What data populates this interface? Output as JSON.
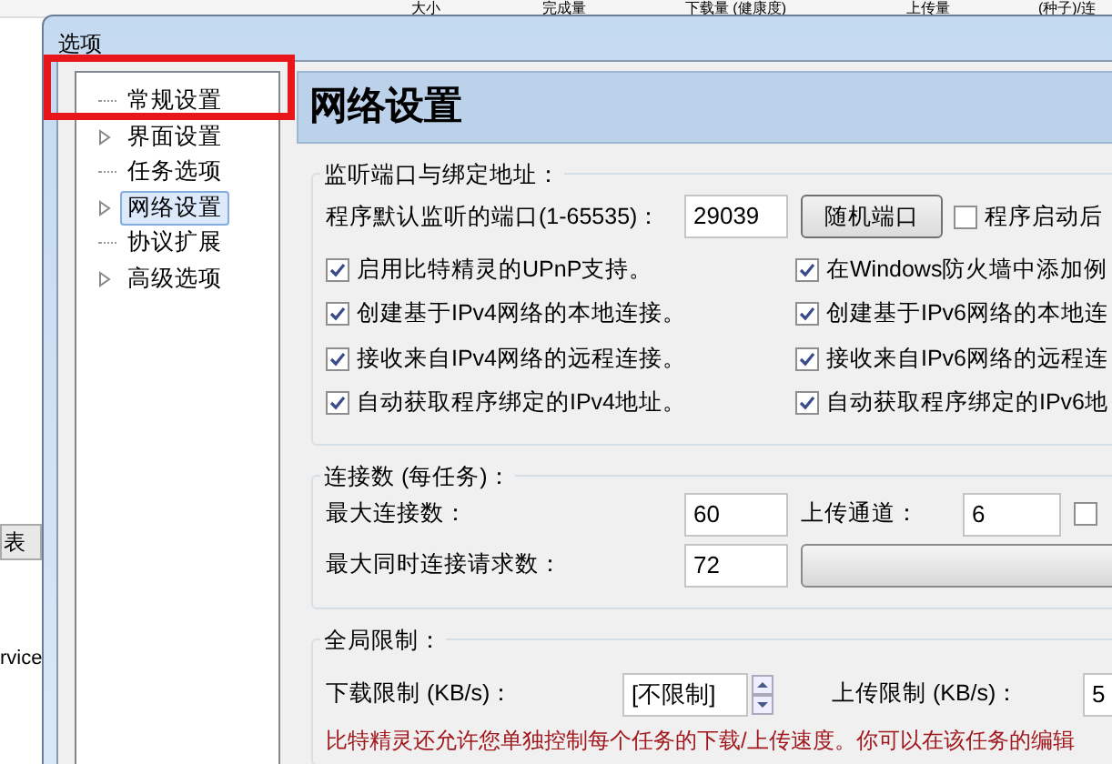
{
  "background_app": {
    "columns": [
      "大小",
      "完成量",
      "下载量 (健康度)",
      "上传量",
      "(种子)/连"
    ],
    "tab": "表",
    "text": "rvice"
  },
  "dialog": {
    "title": "选项"
  },
  "tree": [
    {
      "label": "常规设置",
      "expandable": false,
      "selected": false,
      "highlighted": true
    },
    {
      "label": "界面设置",
      "expandable": true,
      "selected": false
    },
    {
      "label": "任务选项",
      "expandable": false,
      "selected": false
    },
    {
      "label": "网络设置",
      "expandable": true,
      "selected": true
    },
    {
      "label": "协议扩展",
      "expandable": false,
      "selected": false
    },
    {
      "label": "高级选项",
      "expandable": true,
      "selected": false
    }
  ],
  "page": {
    "heading": "网络设置",
    "listen_group": {
      "title": "监听端口与绑定地址：",
      "port_label": "程序默认监听的端口(1-65535)：",
      "port_value": "29039",
      "random_button": "随机端口",
      "bind_checkbox": {
        "label": "程序启动后",
        "checked": false
      },
      "checkboxes": [
        {
          "label": "启用比特精灵的UPnP支持。",
          "checked": true
        },
        {
          "label": "在Windows防火墙中添加例",
          "checked": true
        },
        {
          "label": "创建基于IPv4网络的本地连接。",
          "checked": true
        },
        {
          "label": "创建基于IPv6网络的本地连",
          "checked": true
        },
        {
          "label": "接收来自IPv4网络的远程连接。",
          "checked": true
        },
        {
          "label": "接收来自IPv6网络的远程连",
          "checked": true
        },
        {
          "label": "自动获取程序绑定的IPv4地址。",
          "checked": true
        },
        {
          "label": "自动获取程序绑定的IPv6地",
          "checked": true
        }
      ]
    },
    "connections_group": {
      "title": "连接数 (每任务)：",
      "max_label": "最大连接数：",
      "max_value": "60",
      "upload_label": "上传通道：",
      "upload_value": "6",
      "upload_checkbox": {
        "checked": false
      },
      "requests_label": "最大同时连接请求数：",
      "requests_value": "72"
    },
    "limits_group": {
      "title": "全局限制：",
      "download_label": "下载限制 (KB/s)：",
      "download_value": "[不限制]",
      "upload_label": "上传限制 (KB/s)：",
      "upload_value": "5",
      "note": "比特精灵还允许您单独控制每个任务的下载/上传速度。你可以在该任务的编辑"
    }
  }
}
